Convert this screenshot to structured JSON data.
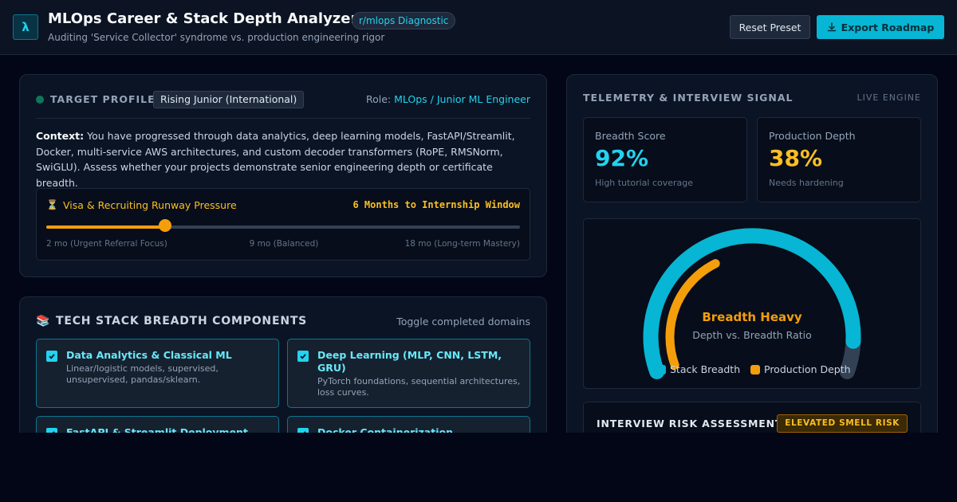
{
  "header": {
    "logo_glyph": "λ",
    "title": "MLOps Career & Stack Depth Analyzer",
    "badge": "r/mlops Diagnostic",
    "subtitle": "Auditing 'Service Collector' syndrome vs. production engineering rigor",
    "reset_label": "Reset Preset",
    "export_label": "Export Roadmap"
  },
  "profile": {
    "heading": "TARGET PROFILE",
    "profile_value": "Rising Junior (International)",
    "role_label": "Role:",
    "role_value": "MLOps / Junior ML Engineer",
    "context_label": "Context:",
    "context_text": "You have progressed through data analytics, deep learning models, FastAPI/Streamlit, Docker, multi-service AWS architectures, and custom decoder transformers (RoPE, RMSNorm, SwiGLU). Assess whether your projects demonstrate senior engineering depth or certificate breadth.",
    "runway": {
      "icon": "⏳",
      "label": "Visa & Recruiting Runway Pressure",
      "value_text": "6 Months to Internship Window",
      "min": 2,
      "max": 18,
      "value": 6,
      "ticks": [
        "2 mo (Urgent Referral Focus)",
        "9 mo (Balanced)",
        "18 mo (Long-term Mastery)"
      ]
    }
  },
  "stack": {
    "icon": "📚",
    "heading": "TECH STACK BREADTH COMPONENTS",
    "hint": "Toggle completed domains",
    "items": [
      {
        "title": "Data Analytics & Classical ML",
        "desc": "Linear/logistic models, supervised, unsupervised, pandas/sklearn.",
        "checked": true
      },
      {
        "title": "Deep Learning (MLP, CNN, LSTM, GRU)",
        "desc": "PyTorch foundations, sequential architectures, loss curves.",
        "checked": true
      },
      {
        "title": "FastAPI & Streamlit Deployment",
        "desc": "",
        "checked": true
      },
      {
        "title": "Docker Containerization",
        "desc": "",
        "checked": true
      }
    ]
  },
  "telemetry": {
    "heading": "TELEMETRY & INTERVIEW SIGNAL",
    "live_label": "LIVE ENGINE",
    "breadth": {
      "label": "Breadth Score",
      "value_text": "92%",
      "note": "High tutorial coverage",
      "color": "#22d3ee"
    },
    "depth": {
      "label": "Production Depth",
      "value_text": "38%",
      "note": "Needs hardening",
      "color": "#fbbf24"
    },
    "gauge": {
      "label": "Breadth Heavy",
      "sub": "Depth vs. Breadth Ratio",
      "breadth_pct": 92,
      "depth_pct": 38,
      "breadth_color": "#06b6d4",
      "depth_color": "#f59e0b",
      "track_color": "#334155",
      "legend": [
        {
          "name": "Stack Breadth",
          "color": "#06b6d4"
        },
        {
          "name": "Production Depth",
          "color": "#f59e0b"
        }
      ]
    },
    "risk": {
      "heading": "INTERVIEW RISK ASSESSMENT",
      "badge": "ELEVATED SMELL RISK"
    }
  }
}
